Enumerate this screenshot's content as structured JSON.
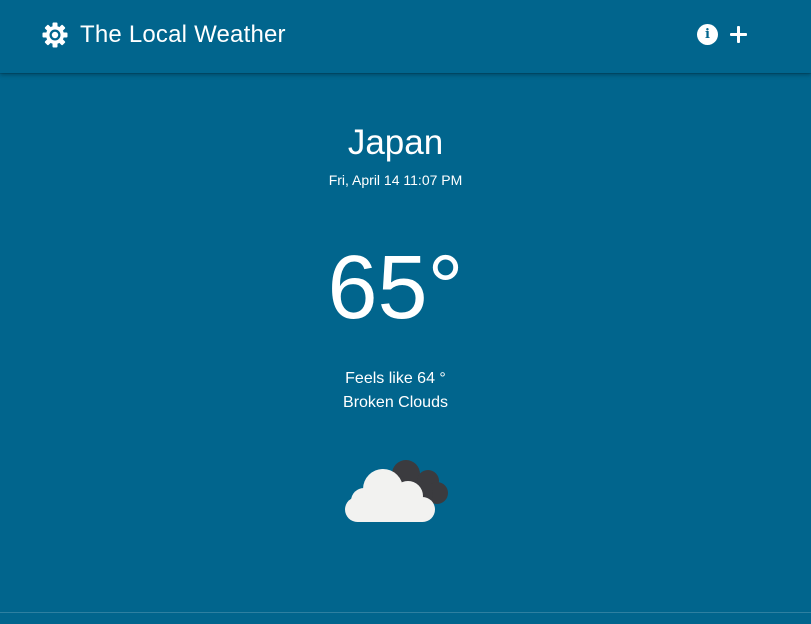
{
  "header": {
    "title": "The Local Weather",
    "settings_icon": "gear-icon",
    "info_label": "i",
    "add_icon": "plus-icon"
  },
  "weather": {
    "location": "Japan",
    "datetime": "Fri, April 14 11:07 PM",
    "temperature": "65°",
    "feels_like": "Feels like 64 °",
    "description": "Broken Clouds",
    "icon": "broken-clouds-icon"
  },
  "colors": {
    "background": "#01658d",
    "text": "#ffffff",
    "cloud_front": "#f2f2f0",
    "cloud_back": "#3b3b3f"
  }
}
